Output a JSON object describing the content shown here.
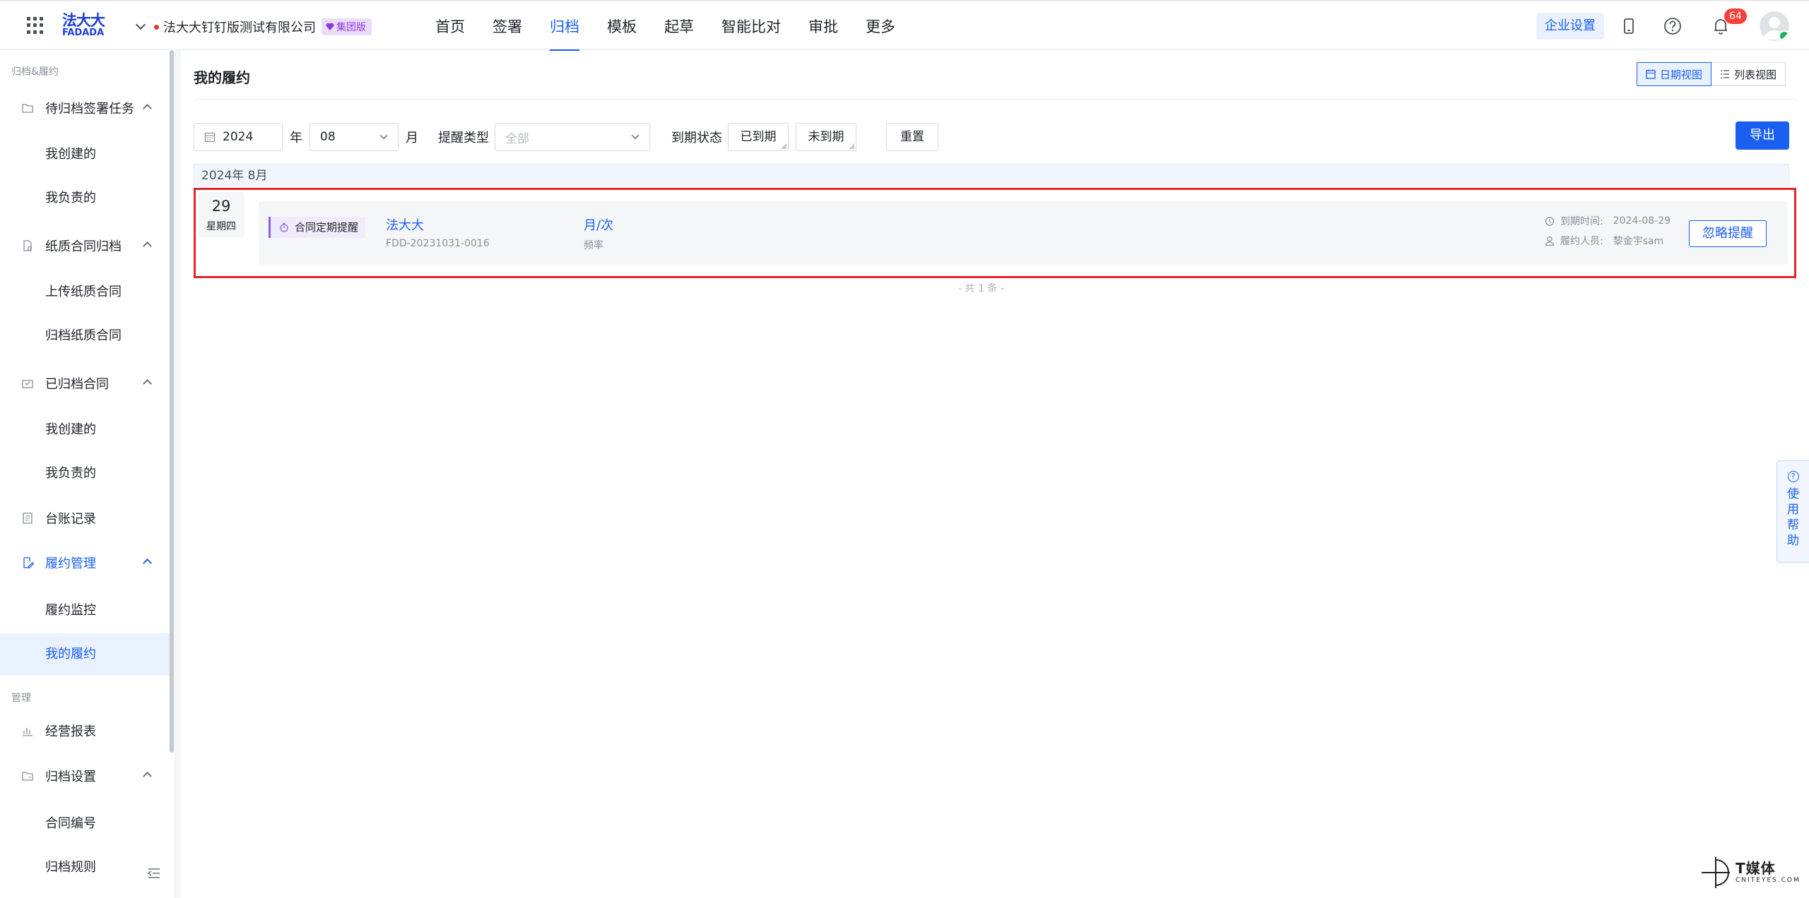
{
  "header": {
    "logo_cn": "法大大",
    "logo_en": "FADADA",
    "company": "法大大钉钉版测试有限公司",
    "badge": "集团版",
    "nav": [
      "首页",
      "签署",
      "归档",
      "模板",
      "起草",
      "智能比对",
      "审批",
      "更多"
    ],
    "active_nav": "归档",
    "enterprise_settings": "企业设置",
    "notification_count": "64",
    "icons": [
      "apps-grid-icon",
      "mobile-icon",
      "help-icon",
      "bell-icon"
    ]
  },
  "sidebar": {
    "section1": "归档&履约",
    "g1": "待归档签署任务",
    "g1_items": [
      "我创建的",
      "我负责的"
    ],
    "g2": "纸质合同归档",
    "g2_items": [
      "上传纸质合同",
      "归档纸质合同"
    ],
    "g3": "已归档合同",
    "g3_items": [
      "我创建的",
      "我负责的"
    ],
    "g4": "台账记录",
    "g5": "履约管理",
    "g5_items": [
      "履约监控",
      "我的履约"
    ],
    "section2": "管理",
    "g6": "经营报表",
    "g7": "归档设置",
    "g7_items": [
      "合同编号",
      "归档规则"
    ]
  },
  "main": {
    "title": "我的履约",
    "view_date": "日期视图",
    "view_list": "列表视图",
    "filters": {
      "year_value": "2024",
      "year_unit": "年",
      "month_value": "08",
      "month_unit": "月",
      "remind_type_label": "提醒类型",
      "remind_type_placeholder": "全部",
      "due_status_label": "到期状态",
      "due_yes": "已到期",
      "due_no": "未到期",
      "reset": "重置",
      "export": "导出"
    },
    "month_header": "2024年 8月",
    "record": {
      "day": "29",
      "weekday": "星期四",
      "tag": "合同定期提醒",
      "party": "法大大",
      "code": "FDD-20231031-0016",
      "frequency": "月/次",
      "frequency_label": "频率",
      "due_label": "到期时间:",
      "due_value": "2024-08-29",
      "person_label": "履约人员:",
      "person_value": "黎金宇sam",
      "ignore": "忽略提醒"
    },
    "total": "- 共 1 条 -"
  },
  "help_tab": [
    "使",
    "用",
    "帮",
    "助"
  ],
  "watermark": {
    "big": "T媒体",
    "small": "CNITEYES.COM"
  },
  "colors": {
    "accent": "#1b5ff0",
    "highlight_border": "#e5242a",
    "badge_bg": "#ecdcfb",
    "notification": "#f5413b"
  }
}
